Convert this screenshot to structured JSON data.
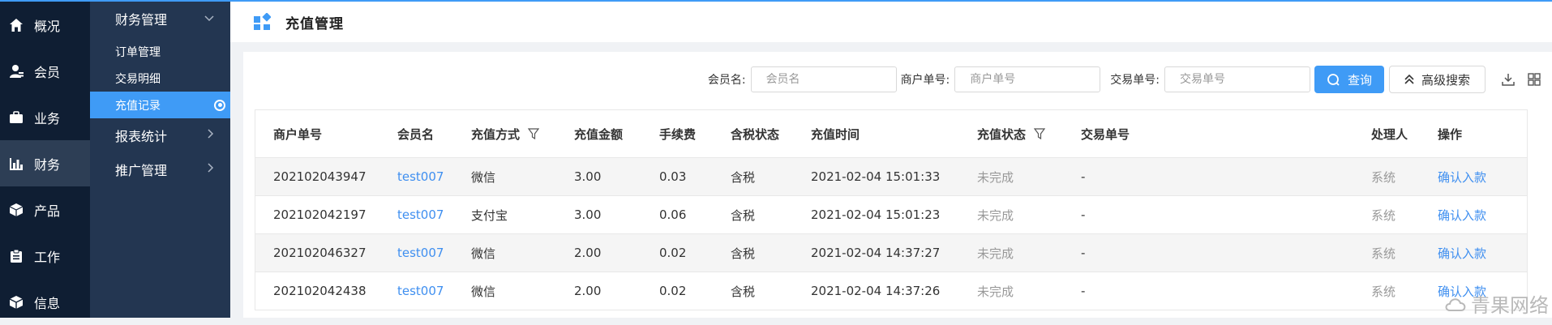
{
  "colors": {
    "accent": "#3f9bf6",
    "nav_dark": "#0f1e33",
    "nav_mid": "#233651",
    "link": "#3f8ff0"
  },
  "primary_nav": [
    {
      "label": "概况",
      "icon": "home-icon"
    },
    {
      "label": "会员",
      "icon": "user-icon"
    },
    {
      "label": "业务",
      "icon": "briefcase-icon"
    },
    {
      "label": "财务",
      "icon": "bar-chart-icon"
    },
    {
      "label": "产品",
      "icon": "box-icon"
    },
    {
      "label": "工作",
      "icon": "clipboard-icon"
    },
    {
      "label": "信息",
      "icon": "cube-icon"
    }
  ],
  "secondary_nav": {
    "group_title": "财务管理",
    "items": [
      "订单管理",
      "交易明细",
      "充值记录"
    ],
    "active_item": "充值记录",
    "other_groups": [
      "报表统计",
      "推广管理"
    ]
  },
  "header": {
    "title": "充值管理"
  },
  "search": {
    "member_label": "会员名:",
    "member_placeholder": "会员名",
    "merchant_label": "商户单号:",
    "merchant_placeholder": "商户单号",
    "trade_label": "交易单号:",
    "trade_placeholder": "交易单号",
    "query_button": "查询",
    "advanced_button": "高级搜索"
  },
  "table": {
    "columns": [
      "商户单号",
      "会员名",
      "充值方式",
      "充值金额",
      "手续费",
      "含税状态",
      "充值时间",
      "充值状态",
      "交易单号",
      "处理人",
      "操作"
    ],
    "rows": [
      [
        "202102043947",
        "test007",
        "微信",
        "3.00",
        "0.03",
        "含税",
        "2021-02-04 15:01:33",
        "未完成",
        "-",
        "系统",
        "确认入款"
      ],
      [
        "202102042197",
        "test007",
        "支付宝",
        "3.00",
        "0.06",
        "含税",
        "2021-02-04 15:01:23",
        "未完成",
        "-",
        "系统",
        "确认入款"
      ],
      [
        "202102046327",
        "test007",
        "微信",
        "2.00",
        "0.02",
        "含税",
        "2021-02-04 14:37:27",
        "未完成",
        "-",
        "系统",
        "确认入款"
      ],
      [
        "202102042438",
        "test007",
        "微信",
        "2.00",
        "0.02",
        "含税",
        "2021-02-04 14:37:26",
        "未完成",
        "-",
        "系统",
        "确认入款"
      ]
    ]
  },
  "watermark": "青果网络"
}
